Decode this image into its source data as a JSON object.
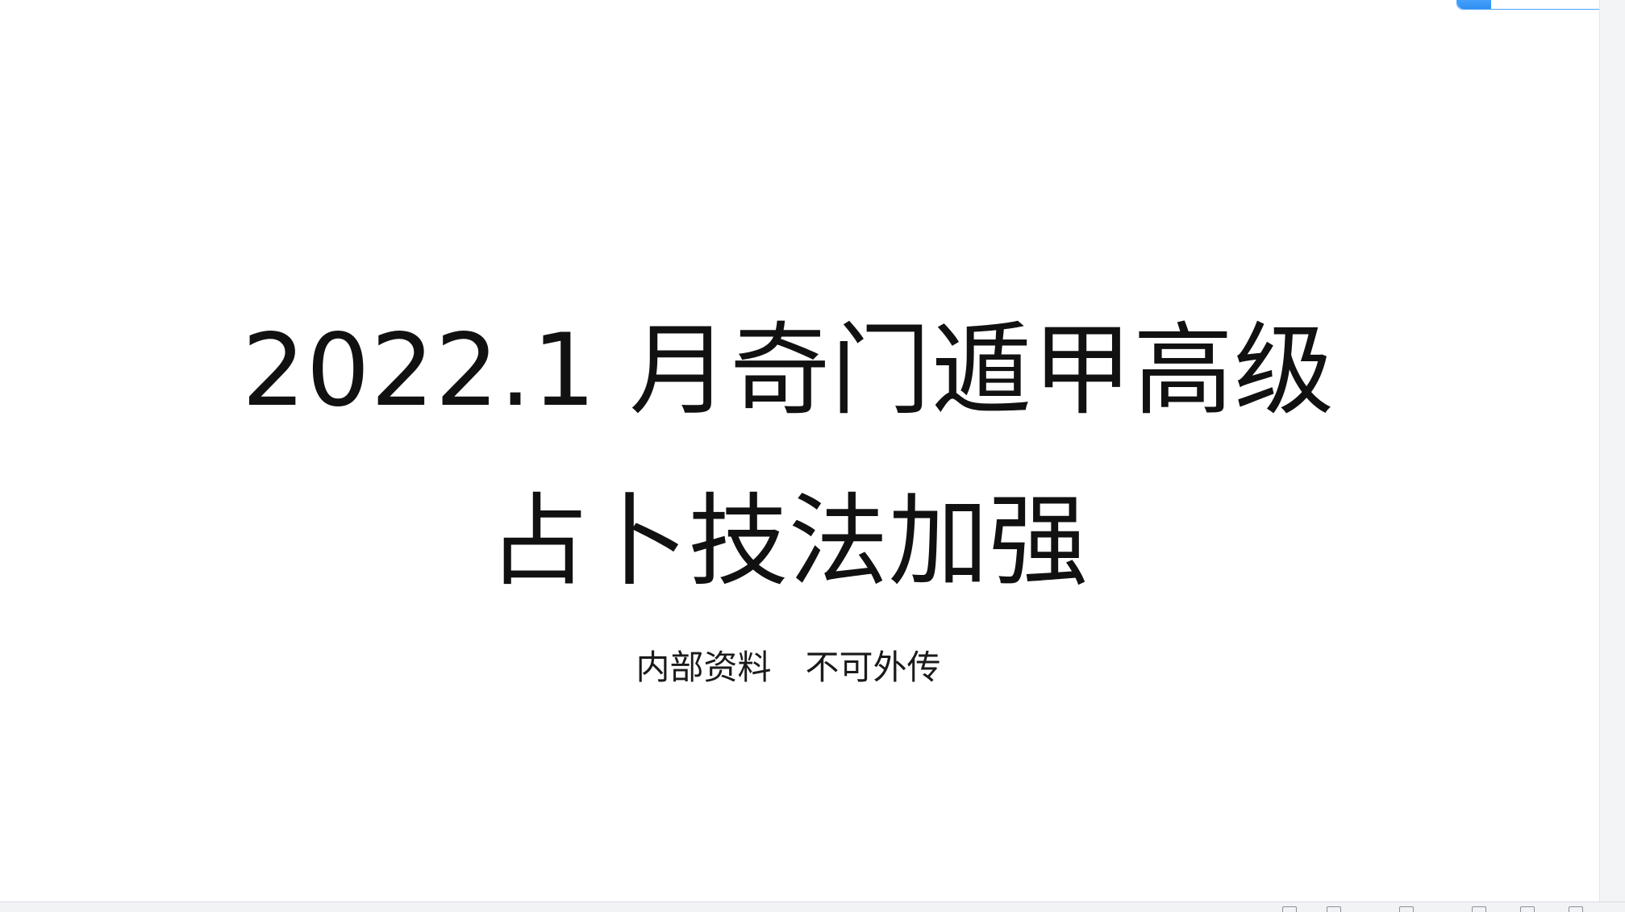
{
  "document": {
    "title_line_1": "2022.1 月奇门遁甲高级",
    "title_line_2": "占卜技法加强",
    "subtitle": "内部资料　不可外传"
  },
  "viewer": {
    "progress_fraction": 0.22,
    "accent_color": "#2f8ef0",
    "bottom_icons": [
      "page-icon",
      "grid-icon",
      "panel-icon",
      "panel-icon",
      "panel-icon",
      "panel-icon"
    ]
  }
}
